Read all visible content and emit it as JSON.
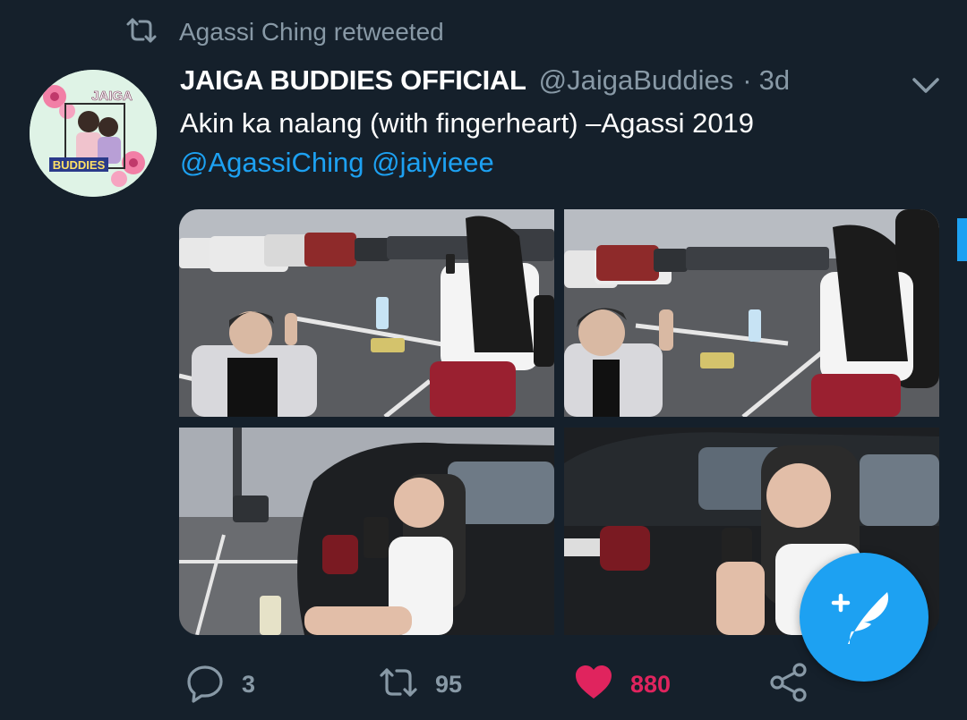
{
  "retweet_banner": {
    "text": "Agassi Ching retweeted"
  },
  "tweet": {
    "author_name": "JAIGA BUDDIES OFFICIAL",
    "author_handle": "@JaigaBuddies",
    "separator": "·",
    "time_ago": "3d",
    "text": "Akin ka nalang (with fingerheart) –Agassi 2019",
    "mentions": [
      "@AgassiChing",
      "@jaiyieee"
    ],
    "avatar_texts": {
      "top": "JAIGA",
      "bottom": "BUDDIES"
    }
  },
  "actions": {
    "reply_count": "3",
    "retweet_count": "95",
    "like_count": "880"
  },
  "colors": {
    "background": "#15202b",
    "secondary_text": "#8899a6",
    "accent": "#1da1f2",
    "like": "#e0245e"
  },
  "icons": [
    "retweet-icon",
    "chevron-down-icon",
    "reply-icon",
    "like-icon",
    "share-icon",
    "compose-tweet-icon"
  ]
}
